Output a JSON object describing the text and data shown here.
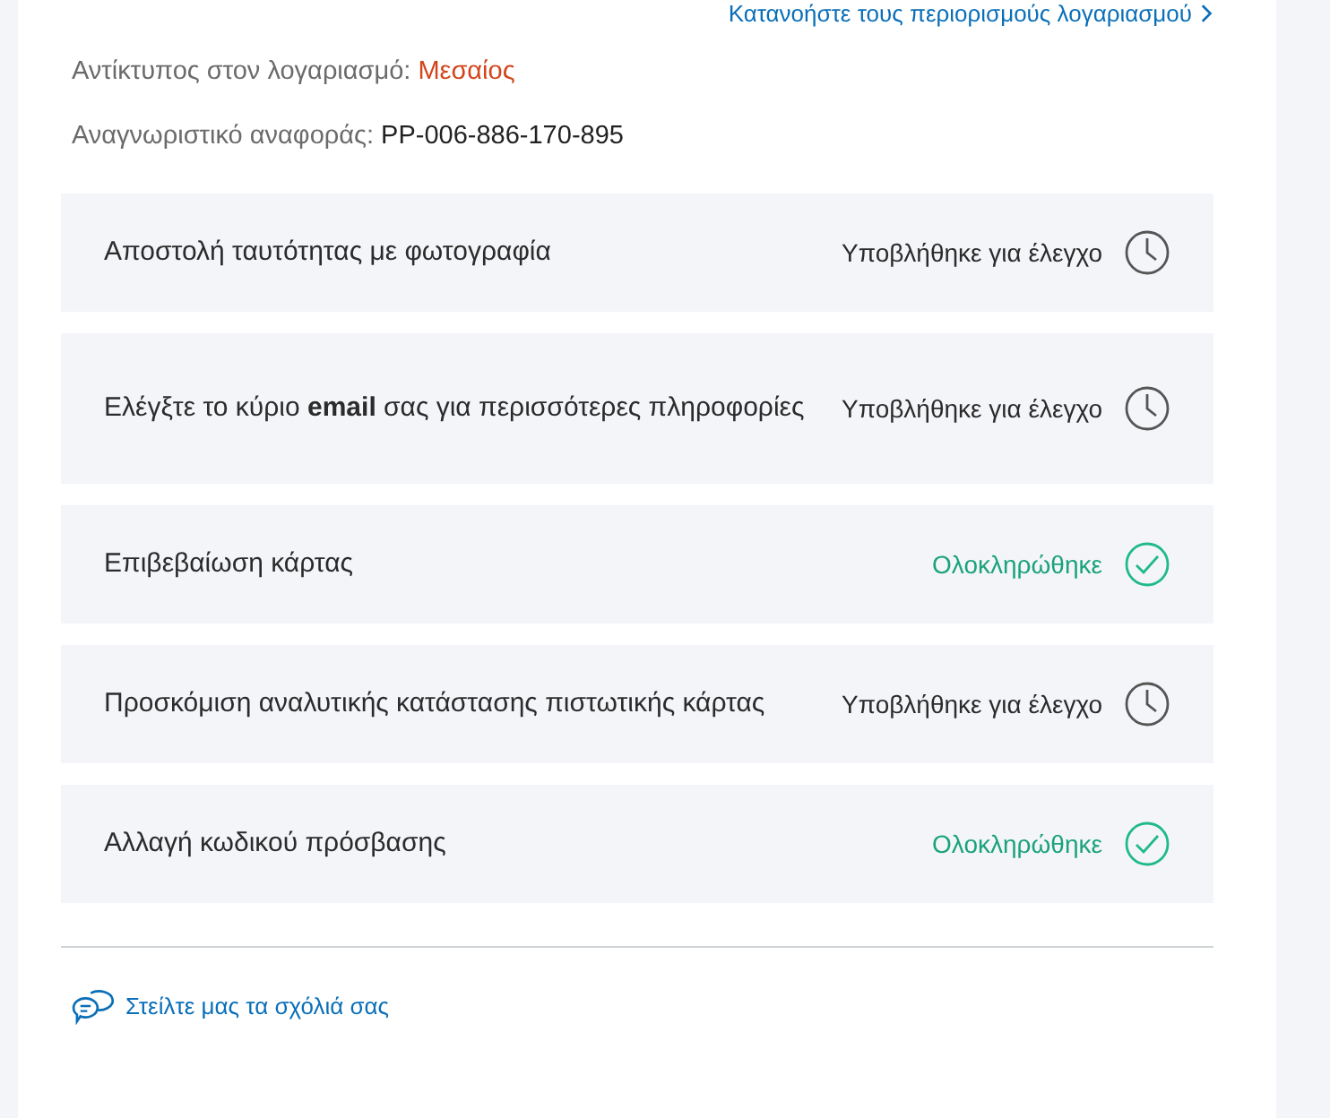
{
  "limits_link": "Κατανοήστε τους περιορισμούς λογαριασμού",
  "impact": {
    "label": "Αντίκτυπος στον λογαριασμό:",
    "value": "Μεσαίος"
  },
  "reference": {
    "label": "Αναγνωριστικό αναφοράς:",
    "value": "PP-006-886-170-895"
  },
  "steps": [
    {
      "title": "Αποστολή ταυτότητας με φωτογραφία",
      "status": "Υποβλήθηκε για έλεγχο",
      "kind": "pending"
    },
    {
      "title": "Ελέγξτε το κύριο **email** σας για περισσότερες πληροφορίες",
      "status": "Υποβλήθηκε για έλεγχο",
      "kind": "pending"
    },
    {
      "title": "Επιβεβαίωση κάρτας",
      "status": "Ολοκληρώθηκε",
      "kind": "done"
    },
    {
      "title": "Προσκόμιση αναλυτικής κατάστασης πιστωτικής κάρτας",
      "status": "Υποβλήθηκε για έλεγχο",
      "kind": "pending"
    },
    {
      "title": "Αλλαγή κωδικού πρόσβασης",
      "status": "Ολοκληρώθηκε",
      "kind": "done"
    }
  ],
  "feedback_link": "Στείλτε μας τα σχόλιά σας"
}
